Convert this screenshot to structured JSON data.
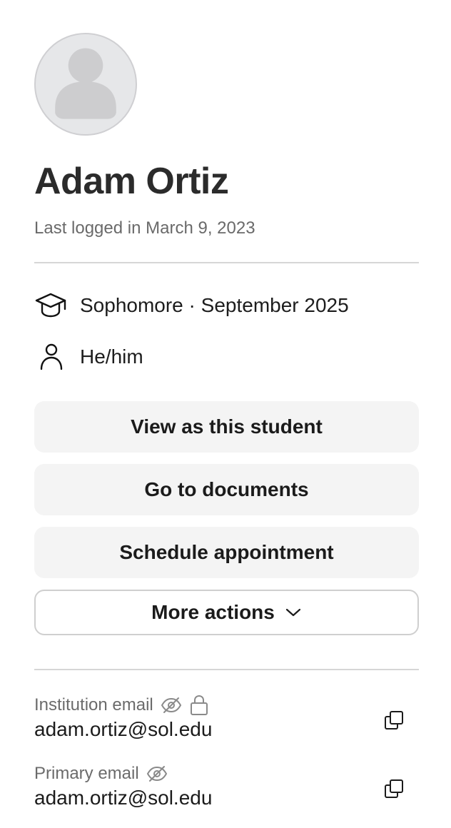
{
  "profile": {
    "name": "Adam Ortiz",
    "last_login": "Last logged in March 9, 2023",
    "avatar_icon": "default-user-avatar"
  },
  "info": {
    "class_year": "Sophomore · September 2025",
    "class_icon": "graduation-cap-icon",
    "pronouns": "He/him",
    "pronouns_icon": "person-icon"
  },
  "actions": {
    "view_as_student": "View as this student",
    "go_to_documents": "Go to documents",
    "schedule_appointment": "Schedule appointment",
    "more_actions": "More actions"
  },
  "emails": [
    {
      "label": "Institution email",
      "value": "adam.ortiz@sol.edu",
      "hidden_icon": "eye-off-icon",
      "locked_icon": "lock-icon",
      "copy_icon": "copy-icon"
    },
    {
      "label": "Primary email",
      "value": "adam.ortiz@sol.edu",
      "hidden_icon": "eye-off-icon",
      "copy_icon": "copy-icon"
    }
  ],
  "colors": {
    "button_bg": "#f4f4f4",
    "divider": "#d6d6d6",
    "muted_text": "#6a6a6a",
    "avatar_bg": "#e6e7e9"
  }
}
